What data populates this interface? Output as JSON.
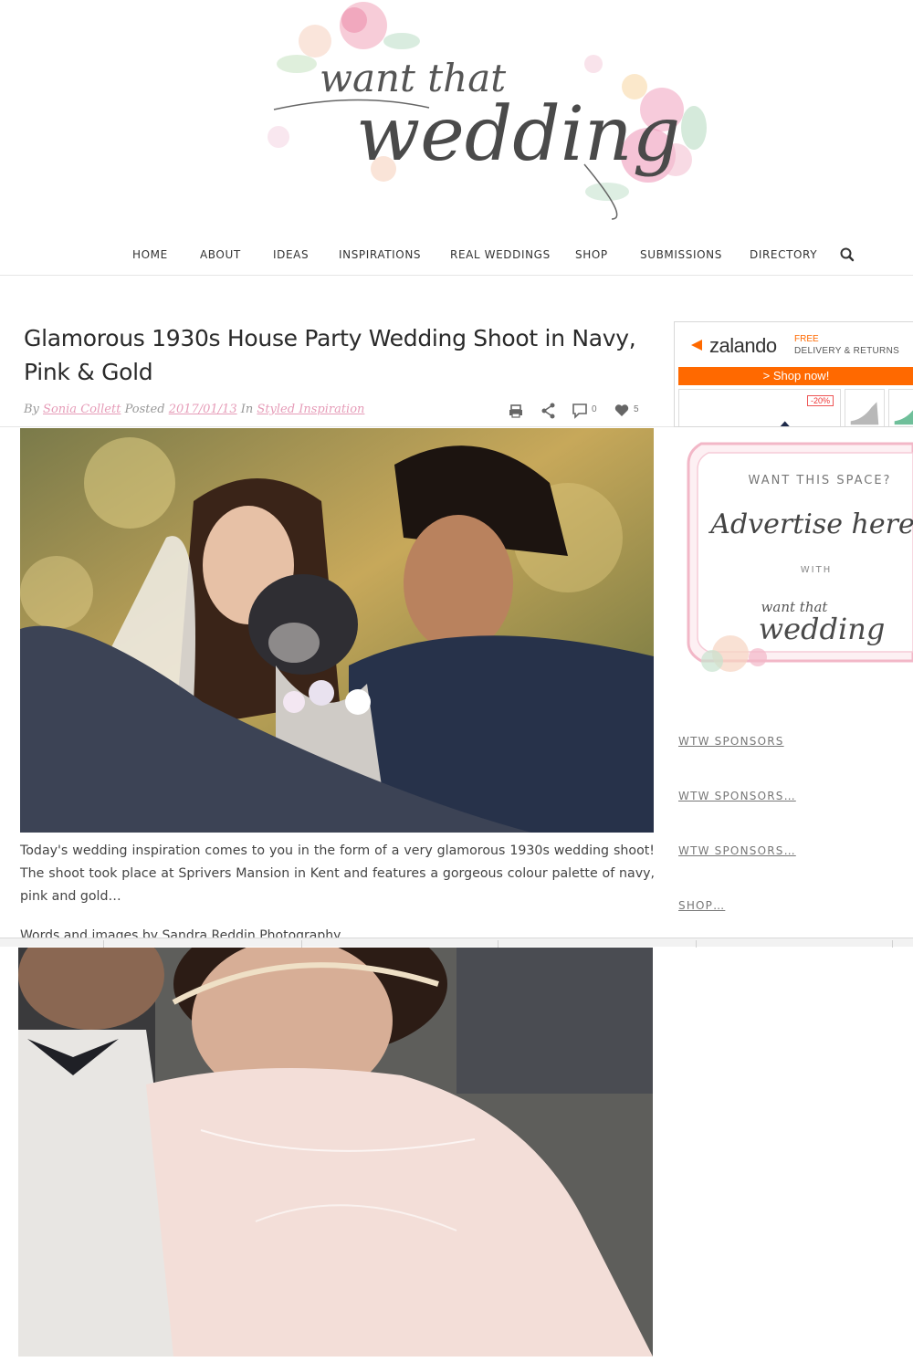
{
  "header": {
    "logo_text_top": "want that",
    "logo_text_main": "wedding"
  },
  "nav": {
    "items": [
      "HOME",
      "ABOUT",
      "IDEAS",
      "INSPIRATIONS",
      "REAL WEDDINGS",
      "SHOP",
      "SUBMISSIONS",
      "DIRECTORY"
    ],
    "search_icon": "search-icon"
  },
  "article": {
    "title": "Glamorous 1930s House Party Wedding Shoot in Navy, Pink & Gold",
    "meta": {
      "by_label": "By",
      "author": "Sonia Collett",
      "posted_label": "Posted",
      "date": "2017/01/13",
      "in_label": "In",
      "category": "Styled Inspiration"
    },
    "tools": {
      "comments_count": "0",
      "likes_count": "5"
    },
    "intro": "Today's wedding inspiration comes to you in the form of a very glamorous 1930s wedding shoot! The shoot took place at Sprivers Mansion in Kent and features a gorgeous colour palette of navy, pink and gold…",
    "credit": "Words and images by Sandra Reddin Photography"
  },
  "sidebar": {
    "zalando": {
      "brand": "zalando",
      "free": "FREE",
      "delivery": "DELIVERY & RETURNS",
      "cta": "> Shop now!",
      "badge": "-20%"
    },
    "ad": {
      "line1": "WANT THIS SPACE?",
      "line2": "Advertise here",
      "line3": "WITH",
      "line4": "want that",
      "line5": "wedding"
    },
    "sponsors": [
      "WTW SPONSORS",
      "WTW SPONSORS…",
      "WTW SPONSORS…",
      "SHOP…"
    ]
  },
  "colors": {
    "accent_pink": "#e69cb8",
    "zalando_orange": "#ff6900",
    "text": "#444444"
  }
}
